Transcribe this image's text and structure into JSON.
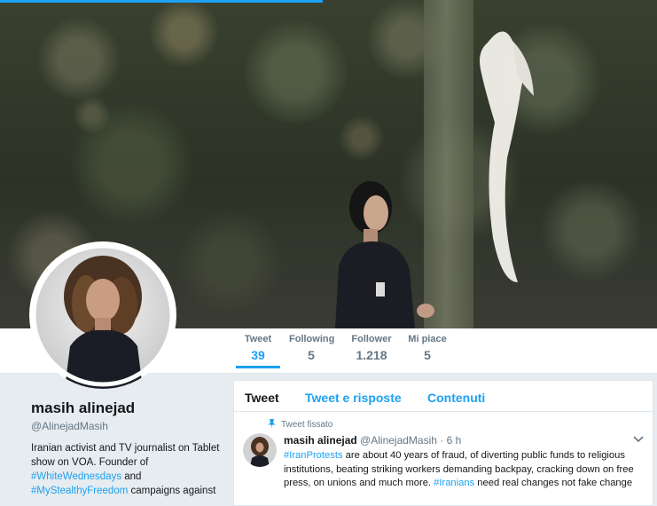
{
  "nav": {
    "stats": [
      {
        "label": "Tweet",
        "value": "39"
      },
      {
        "label": "Following",
        "value": "5"
      },
      {
        "label": "Follower",
        "value": "1.218"
      },
      {
        "label": "Mi piace",
        "value": "5"
      }
    ]
  },
  "profile": {
    "name": "masih alinejad",
    "handle": "@AlinejadMasih",
    "bio": {
      "line1": "Iranian activist and TV journalist on Tablet show on VOA. Founder of",
      "tag1": "#WhiteWednesdays",
      "mid": "and",
      "tag2": "#MyStealthyFreedom",
      "end": "campaigns against"
    }
  },
  "timeline": {
    "tabs": [
      "Tweet",
      "Tweet e risposte",
      "Contenuti"
    ],
    "pinned_label": "Tweet fissato",
    "tweet": {
      "name": "masih alinejad",
      "handle": "@AlinejadMasih",
      "separator": "·",
      "time": "6 h",
      "tag1": "#IranProtests",
      "text1": "are about 40 years of fraud, of diverting public funds to religious institutions, beating striking workers demanding backpay, cracking down on free press, on unions and much more.",
      "tag2": "#Iranians",
      "text2": "need real changes not fake change"
    }
  },
  "colors": {
    "accent": "#1da1f2",
    "text_secondary": "#657786",
    "background": "#e6ecf0"
  },
  "icons": [
    "pin-icon",
    "chevron-down-icon"
  ]
}
